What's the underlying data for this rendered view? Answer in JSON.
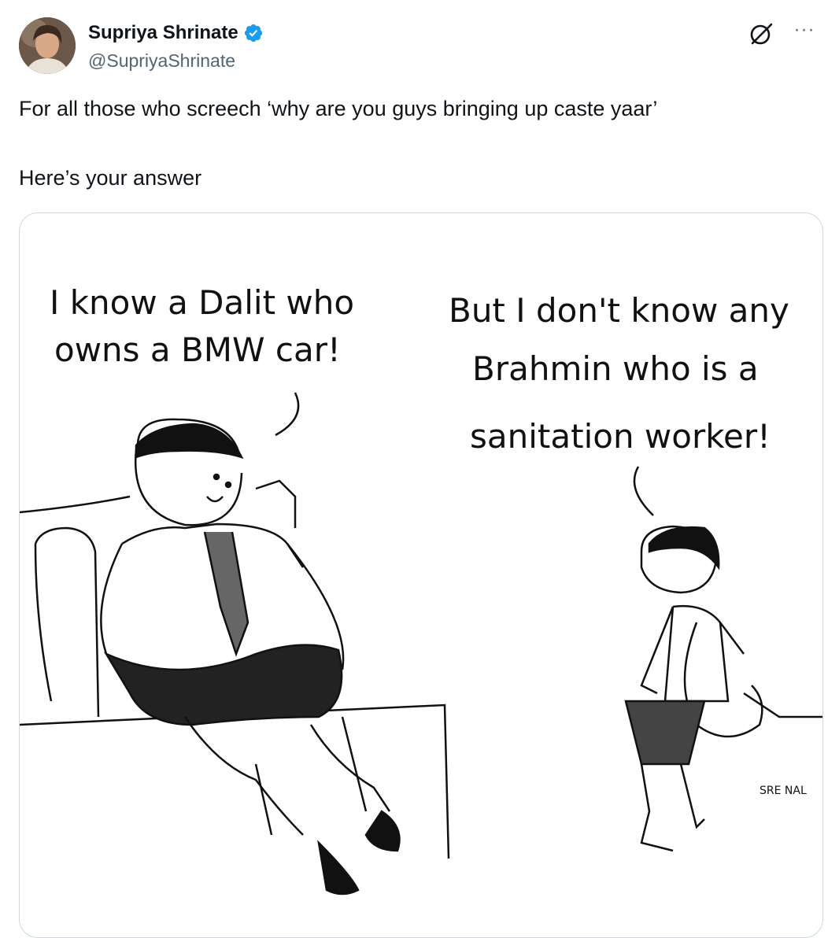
{
  "author": {
    "display_name": "Supriya Shrinate",
    "handle": "@SupriyaShrinate",
    "verified": true,
    "verified_color": "#1d9bf0"
  },
  "actions": {
    "grok_icon": "grok-icon",
    "more_label": "···"
  },
  "tweet": {
    "line1": "For all those who screech ‘why are you guys bringing up caste yaar’",
    "line2": "Here’s your answer"
  },
  "media": {
    "bubble_left": [
      "I know a Dalit who",
      "owns a BMW car!"
    ],
    "bubble_right": [
      "But I don't know any",
      "Brahmin who is a",
      "sanitation worker!"
    ],
    "signature": "SRE NAL"
  }
}
